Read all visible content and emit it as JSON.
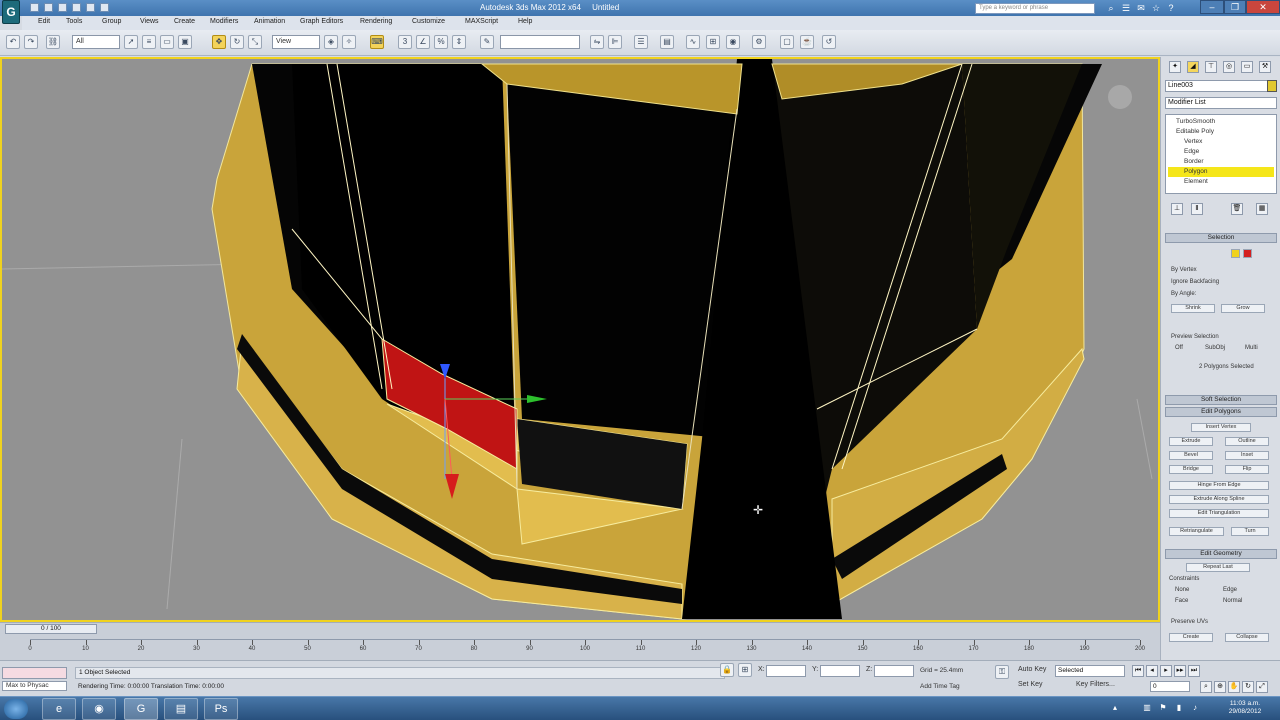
{
  "titlebar": {
    "title": "Autodesk 3ds Max 2012 x64     Untitled",
    "search_placeholder": "Type a keyword or phrase",
    "icons": [
      "binoculars-icon",
      "help-icon",
      "star-icon",
      "question-icon"
    ]
  },
  "menubar": {
    "items": [
      "Edit",
      "Tools",
      "Group",
      "Views",
      "Create",
      "Modifiers",
      "Animation",
      "Graph Editors",
      "Rendering",
      "Customize",
      "MAXScript",
      "Help"
    ]
  },
  "toolbar": {
    "selection_filter": "All",
    "reference_coord": "View",
    "named_selection": ""
  },
  "command_panel": {
    "object_name": "Line003",
    "modifier_list": "Modifier List",
    "stack": [
      {
        "label": "TurboSmooth",
        "selected": false
      },
      {
        "label": "Editable Poly",
        "selected": false
      },
      {
        "label": "Vertex",
        "selected": false
      },
      {
        "label": "Edge",
        "selected": false
      },
      {
        "label": "Border",
        "selected": false
      },
      {
        "label": "Polygon",
        "selected": true
      },
      {
        "label": "Element",
        "selected": false
      }
    ],
    "selection_rollout": "Selection",
    "by_vertex": "By Vertex",
    "ignore_backfacing": "Ignore Backfacing",
    "by_angle": "By Angle:",
    "shrink": "Shrink",
    "grow": "Grow",
    "preview_selection": "Preview Selection",
    "preview_off": "Off",
    "preview_subobj": "SubObj",
    "preview_multi": "Multi",
    "selected_count": "2 Polygons Selected",
    "soft_selection_rollout": "Soft Selection",
    "edit_polygons_rollout": "Edit Polygons",
    "insert_vertex": "Insert Vertex",
    "extrude": "Extrude",
    "outline": "Outline",
    "bevel": "Bevel",
    "inset": "Inset",
    "bridge": "Bridge",
    "flip": "Flip",
    "hinge_from_edge": "Hinge From Edge",
    "extrude_along_spline": "Extrude Along Spline",
    "edit_triangulation": "Edit Triangulation",
    "retriangulate": "Retriangulate",
    "turn": "Turn",
    "edit_geometry_rollout": "Edit Geometry",
    "repeat_last": "Repeat Last",
    "constraints": "Constraints",
    "none": "None",
    "edge": "Edge",
    "face": "Face",
    "normal": "Normal",
    "preserve_uvs": "Preserve UVs",
    "create": "Create",
    "collapse": "Collapse"
  },
  "trackbar": {
    "time_slider": "0 / 100",
    "ticks": [
      0,
      10,
      20,
      30,
      40,
      50,
      60,
      70,
      80,
      90,
      100,
      110,
      120,
      130,
      140,
      150,
      160,
      170,
      180,
      190,
      200
    ]
  },
  "statusbar": {
    "maxscript_label": "Max to Physac",
    "status_line1": "1 Object Selected",
    "status_line2": "Rendering Time: 0:00:00     Translation Time: 0:00:00",
    "x_label": "X:",
    "y_label": "Y:",
    "z_label": "Z:",
    "grid": "Grid = 25.4mm",
    "auto_key": "Auto Key",
    "set_key": "Set Key",
    "key_filter": "Selected",
    "key_filters_btn": "Key Filters...",
    "add_time_tag": "Add Time Tag",
    "frame": "0"
  },
  "taskbar": {
    "time": "11:03 a.m.",
    "date": "29/08/2012",
    "apps": [
      "ie-icon",
      "chrome-icon",
      "3dsmax-icon",
      "folder-icon",
      "photoshop-icon"
    ]
  },
  "colors": {
    "selection_yellow": "#f0d21e",
    "polygon_selected": "#c81515",
    "mesh_gold": "#d9b43a"
  }
}
